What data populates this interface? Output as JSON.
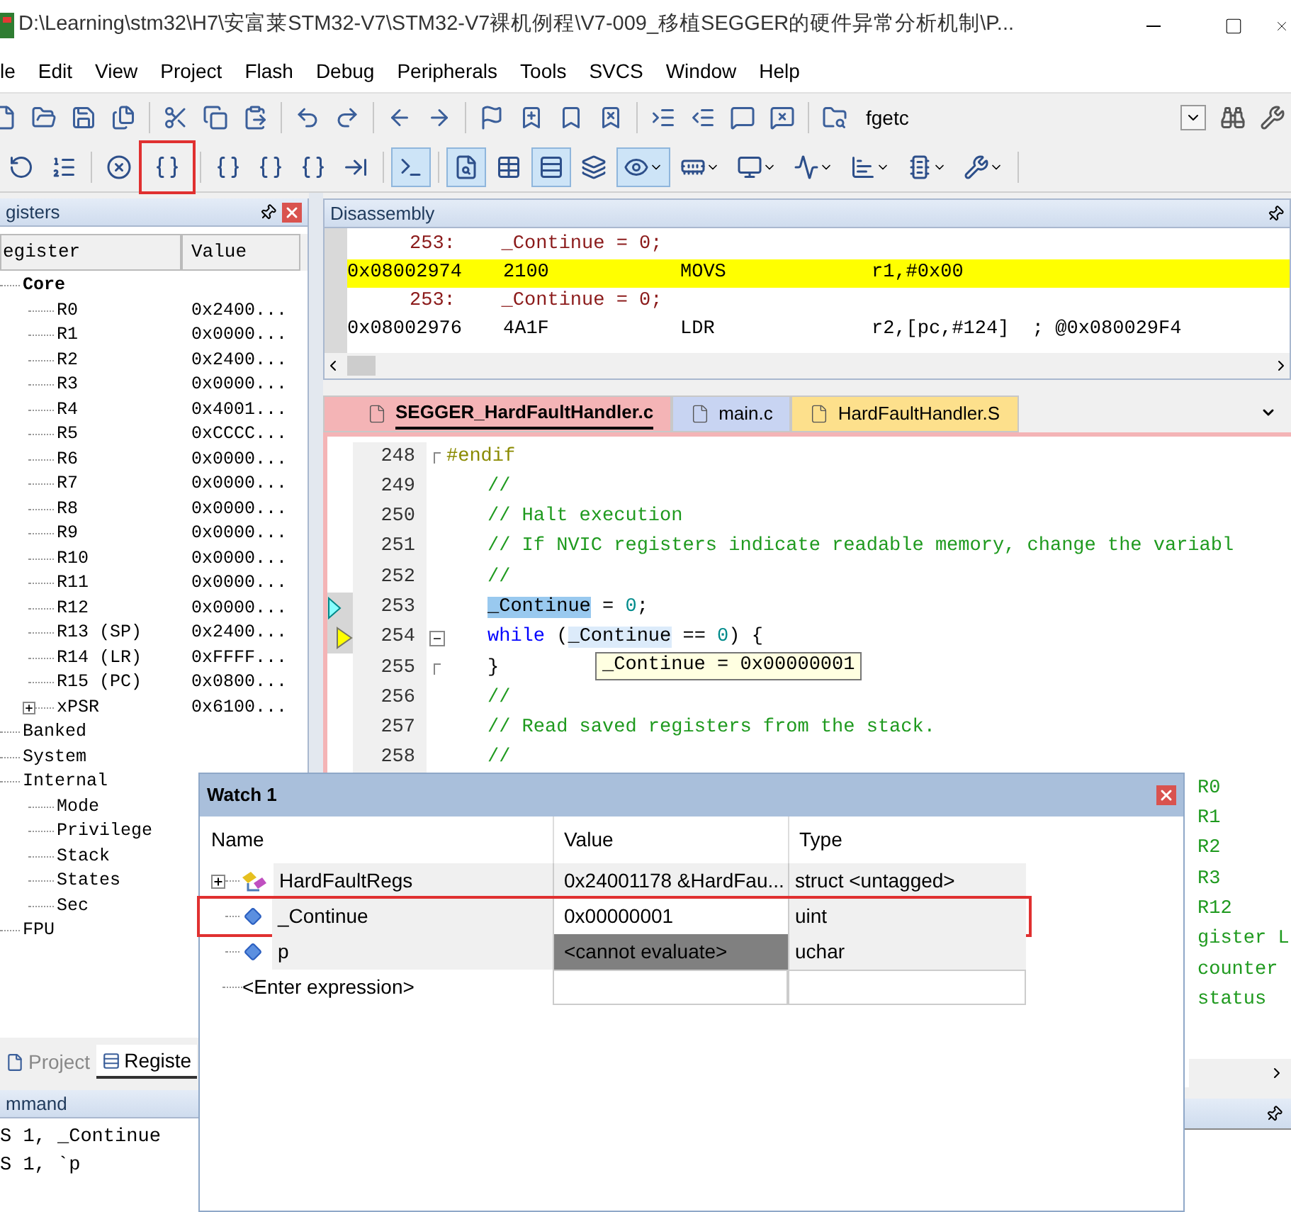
{
  "window": {
    "title": "D:\\Learning\\stm32\\H7\\安富莱STM32-V7\\STM32-V7裸机例程\\V7-009_移植SEGGER的硬件异常分析机制\\P..."
  },
  "menu": [
    "le",
    "Edit",
    "View",
    "Project",
    "Flash",
    "Debug",
    "Peripherals",
    "Tools",
    "SVCS",
    "Window",
    "Help"
  ],
  "toolbar": {
    "find_combo": {
      "value": "fgetc"
    }
  },
  "debug_toolbar": [
    {
      "pressed": false,
      "highlighted": false,
      "dropdown": false
    },
    {
      "pressed": false,
      "highlighted": false,
      "dropdown": false
    },
    {
      "pressed": false,
      "highlighted": false,
      "dropdown": false
    },
    {
      "pressed": false,
      "highlighted": true,
      "dropdown": false
    },
    {
      "pressed": false,
      "highlighted": false,
      "dropdown": false
    },
    {
      "pressed": false,
      "highlighted": false,
      "dropdown": false
    },
    {
      "pressed": false,
      "highlighted": false,
      "dropdown": false
    },
    {
      "pressed": false,
      "highlighted": false,
      "dropdown": false
    },
    {
      "pressed": true,
      "highlighted": false,
      "dropdown": false
    },
    {
      "pressed": true,
      "highlighted": false,
      "dropdown": false
    },
    {
      "pressed": false,
      "highlighted": false,
      "dropdown": false
    },
    {
      "pressed": true,
      "highlighted": false,
      "dropdown": false
    },
    {
      "pressed": false,
      "highlighted": false,
      "dropdown": false
    },
    {
      "pressed": true,
      "highlighted": false,
      "dropdown": true
    },
    {
      "pressed": false,
      "highlighted": false,
      "dropdown": true
    },
    {
      "pressed": false,
      "highlighted": false,
      "dropdown": true
    },
    {
      "pressed": false,
      "highlighted": false,
      "dropdown": true
    },
    {
      "pressed": false,
      "highlighted": false,
      "dropdown": true
    },
    {
      "pressed": false,
      "highlighted": false,
      "dropdown": true
    },
    {
      "pressed": false,
      "highlighted": false,
      "dropdown": true
    }
  ],
  "registers": {
    "title": "gisters",
    "columns": [
      "egister",
      "Value"
    ],
    "tree": [
      {
        "name": "Core",
        "bold": true,
        "children": [
          {
            "name": "R0",
            "value": "0x2400..."
          },
          {
            "name": "R1",
            "value": "0x0000..."
          },
          {
            "name": "R2",
            "value": "0x2400..."
          },
          {
            "name": "R3",
            "value": "0x0000..."
          },
          {
            "name": "R4",
            "value": "0x4001..."
          },
          {
            "name": "R5",
            "value": "0xCCCC..."
          },
          {
            "name": "R6",
            "value": "0x0000..."
          },
          {
            "name": "R7",
            "value": "0x0000..."
          },
          {
            "name": "R8",
            "value": "0x0000..."
          },
          {
            "name": "R9",
            "value": "0x0000..."
          },
          {
            "name": "R10",
            "value": "0x0000..."
          },
          {
            "name": "R11",
            "value": "0x0000..."
          },
          {
            "name": "R12",
            "value": "0x0000..."
          },
          {
            "name": "R13 (SP)",
            "value": "0x2400..."
          },
          {
            "name": "R14 (LR)",
            "value": "0xFFFF..."
          },
          {
            "name": "R15 (PC)",
            "value": "0x0800..."
          },
          {
            "name": "xPSR",
            "value": "0x6100...",
            "expandable": true
          }
        ]
      },
      {
        "name": "Banked",
        "bold": false
      },
      {
        "name": "System",
        "bold": false
      },
      {
        "name": "Internal",
        "bold": false,
        "children": [
          {
            "name": "Mode"
          },
          {
            "name": "Privilege"
          },
          {
            "name": "Stack"
          },
          {
            "name": "States"
          },
          {
            "name": "Sec"
          }
        ]
      },
      {
        "name": "FPU",
        "bold": false
      }
    ]
  },
  "left_tabs": [
    {
      "label": "Project",
      "selected": false
    },
    {
      "label": "Registe",
      "selected": true
    }
  ],
  "command": {
    "title": "mmand",
    "lines": [
      "S 1, _Continue",
      "S 1, `p"
    ]
  },
  "disassembly": {
    "title": "Disassembly",
    "lines": [
      {
        "kind": "source",
        "text": "253:    _Continue = 0;",
        "current": false
      },
      {
        "kind": "asm",
        "address": "0x08002974",
        "opcode": "2100",
        "mnemonic": "MOVS",
        "operands": "r1,#0x00",
        "current": true
      },
      {
        "kind": "source",
        "text": "253:    _Continue = 0;",
        "current": false
      },
      {
        "kind": "asm",
        "address": "0x08002976",
        "opcode": "4A1F",
        "mnemonic": "LDR",
        "operands": "r2,[pc,#124]  ; @0x080029F4",
        "current": false
      }
    ]
  },
  "editor_tabs": [
    {
      "label": "SEGGER_HardFaultHandler.c",
      "selected": true,
      "color": "#f4b4b6"
    },
    {
      "label": "main.c",
      "selected": false,
      "color": "#c8d4f2"
    },
    {
      "label": "HardFaultHandler.S",
      "selected": false,
      "color": "#fde08c"
    }
  ],
  "editor": {
    "lines": [
      {
        "number": "248",
        "cursor_arrow": false,
        "execution_arrow": false,
        "fold_start": false,
        "fold_end": true,
        "segments": [
          {
            "kind": "preproc",
            "text": "#endif"
          }
        ]
      },
      {
        "number": "249",
        "cursor_arrow": false,
        "execution_arrow": false,
        "fold_start": false,
        "fold_end": false,
        "segments": [
          {
            "kind": "comment",
            "text": "//"
          }
        ]
      },
      {
        "number": "250",
        "cursor_arrow": false,
        "execution_arrow": false,
        "fold_start": false,
        "fold_end": false,
        "segments": [
          {
            "kind": "comment",
            "text": "// Halt execution"
          }
        ]
      },
      {
        "number": "251",
        "cursor_arrow": false,
        "execution_arrow": false,
        "fold_start": false,
        "fold_end": false,
        "segments": [
          {
            "kind": "comment",
            "text": "// If NVIC registers indicate readable memory, change the variabl"
          }
        ]
      },
      {
        "number": "252",
        "cursor_arrow": false,
        "execution_arrow": false,
        "fold_start": false,
        "fold_end": false,
        "segments": [
          {
            "kind": "comment",
            "text": "//"
          }
        ]
      },
      {
        "number": "253",
        "cursor_arrow": true,
        "execution_arrow": false,
        "fold_start": false,
        "fold_end": false,
        "segments": [
          {
            "kind": "selection",
            "text": "_Continue"
          },
          {
            "kind": "plain",
            "text": " = "
          },
          {
            "kind": "number",
            "text": "0"
          },
          {
            "kind": "plain",
            "text": ";"
          }
        ]
      },
      {
        "number": "254",
        "cursor_arrow": false,
        "execution_arrow": true,
        "fold_start": true,
        "fold_end": false,
        "segments": [
          {
            "kind": "keyword",
            "text": "while"
          },
          {
            "kind": "plain",
            "text": " ("
          },
          {
            "kind": "hover",
            "text": "_Continue"
          },
          {
            "kind": "plain",
            "text": " == "
          },
          {
            "kind": "number",
            "text": "0"
          },
          {
            "kind": "plain",
            "text": ") {"
          }
        ]
      },
      {
        "number": "255",
        "cursor_arrow": false,
        "execution_arrow": false,
        "fold_start": false,
        "fold_end": true,
        "segments": [
          {
            "kind": "plain",
            "text": "}"
          }
        ]
      },
      {
        "number": "256",
        "cursor_arrow": false,
        "execution_arrow": false,
        "fold_start": false,
        "fold_end": false,
        "segments": [
          {
            "kind": "comment",
            "text": "//"
          }
        ]
      },
      {
        "number": "257",
        "cursor_arrow": false,
        "execution_arrow": false,
        "fold_start": false,
        "fold_end": false,
        "segments": [
          {
            "kind": "comment",
            "text": "// Read saved registers from the stack."
          }
        ]
      },
      {
        "number": "258",
        "cursor_arrow": false,
        "execution_arrow": false,
        "fold_start": false,
        "fold_end": false,
        "segments": [
          {
            "kind": "comment",
            "text": "//"
          }
        ]
      }
    ],
    "line_tails": [
      "R0",
      "R1",
      "R2",
      "R3",
      "R12",
      "gister L",
      "counter",
      "status"
    ],
    "tooltip": "_Continue = 0x00000001"
  },
  "watch": {
    "title": "Watch 1",
    "columns": [
      "Name",
      "Value",
      "Type"
    ],
    "rows": [
      {
        "kind": "struct",
        "name": "HardFaultRegs",
        "value": "0x24001178 &HardFau...",
        "type": "struct <untagged>",
        "highlighted": false,
        "error": false
      },
      {
        "kind": "variable",
        "name": "_Continue",
        "value": "0x00000001",
        "type": "uint",
        "highlighted": true,
        "error": false
      },
      {
        "kind": "variable",
        "name": "p",
        "value": "<cannot evaluate>",
        "type": "uchar",
        "highlighted": false,
        "error": true
      }
    ],
    "placeholder": "<Enter expression>"
  }
}
